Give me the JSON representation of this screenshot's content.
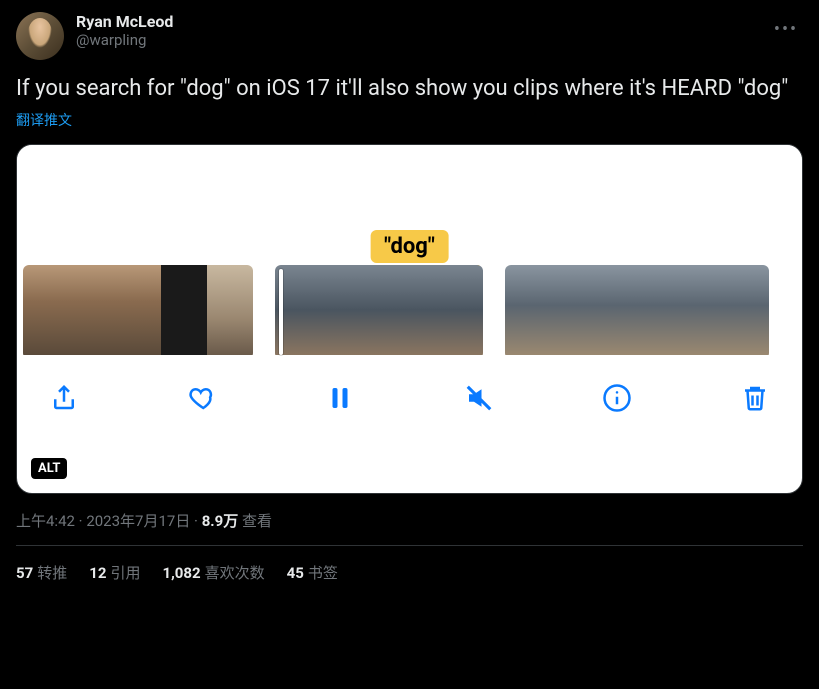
{
  "author": {
    "display_name": "Ryan McLeod",
    "username": "@warpling"
  },
  "tweet_text": "If you search for \"dog\" on iOS 17 it'll also show you clips where it's HEARD \"dog\"",
  "translate_label": "翻译推文",
  "media": {
    "highlight_label": "\"dog\"",
    "alt_badge": "ALT"
  },
  "meta": {
    "time": "上午4:42",
    "dot1": " · ",
    "date": "2023年7月17日",
    "dot2": " · ",
    "views_count": "8.9万",
    "views_label": " 查看"
  },
  "stats": {
    "retweets": {
      "count": "57",
      "label": "转推"
    },
    "quotes": {
      "count": "12",
      "label": "引用"
    },
    "likes": {
      "count": "1,082",
      "label": "喜欢次数"
    },
    "bookmarks": {
      "count": "45",
      "label": "书签"
    }
  }
}
